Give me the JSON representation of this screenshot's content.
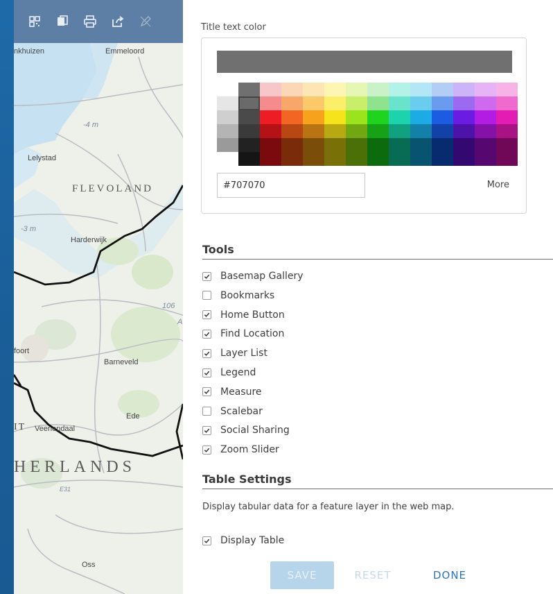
{
  "toolbar": {
    "icons": [
      "qr-code-icon",
      "copy-icon",
      "print-icon",
      "share-icon",
      "pencil-icon"
    ]
  },
  "map": {
    "labels": {
      "enkhuizen": "nkhuizen",
      "emmeloord": "Emmeloord",
      "elev1": "-4 m",
      "lelystad": "Lelystad",
      "flevoland": "FLEVOLAND",
      "elev2": "-3 m",
      "harderwijk": "Harderwijk",
      "road106": "106",
      "a": "A",
      "amersfoort": "foort",
      "barneveld": "Barneveld",
      "ede": "Ede",
      "veenendaal": "Veenendaal",
      "ut": "IT",
      "netherlands": "HERLANDS",
      "e31": "E31",
      "oss": "Oss"
    }
  },
  "panel": {
    "title_color_label": "Title text color",
    "preview_color": "#707070",
    "hex_value": "#707070",
    "more_label": "More",
    "tools_heading": "Tools",
    "tools": [
      {
        "label": "Basemap Gallery",
        "checked": true
      },
      {
        "label": "Bookmarks",
        "checked": false
      },
      {
        "label": "Home Button",
        "checked": true
      },
      {
        "label": "Find Location",
        "checked": true
      },
      {
        "label": "Layer List",
        "checked": true
      },
      {
        "label": "Legend",
        "checked": true
      },
      {
        "label": "Measure",
        "checked": true
      },
      {
        "label": "Scalebar",
        "checked": false
      },
      {
        "label": "Social Sharing",
        "checked": true
      },
      {
        "label": "Zoom Slider",
        "checked": true
      }
    ],
    "table_heading": "Table Settings",
    "table_description": "Display tabular data for a feature layer in the web map.",
    "display_table": {
      "label": "Display Table",
      "checked": true
    }
  },
  "footer": {
    "save_label": "SAVE",
    "reset_label": "RESET",
    "done_label": "DONE"
  },
  "palette": {
    "grays": [
      "#707070",
      "#e6e6e6",
      "#cfcfcf",
      "#b4b4b4",
      "#9a9a9a"
    ],
    "grays2": [
      "#707070",
      "#6a6a6a",
      "#4a4a4a",
      "#3a3a3a",
      "#222222",
      "#151515"
    ],
    "columns": [
      [
        "#f7c6c8",
        "#f48c8f",
        "#ee1c24",
        "#b51218",
        "#7a0a0e"
      ],
      [
        "#fbd7b5",
        "#f7a76a",
        "#f26522",
        "#b94714",
        "#7a2c0a"
      ],
      [
        "#fde6b3",
        "#fbc96a",
        "#f7a21c",
        "#b87412",
        "#7a4d08"
      ],
      [
        "#fdf6b3",
        "#fbee6a",
        "#f7e31c",
        "#b8a812",
        "#7a7008"
      ],
      [
        "#e6f7b3",
        "#c9ee6a",
        "#9be31c",
        "#71a812",
        "#4b7008"
      ],
      [
        "#c9f2c9",
        "#8fe38f",
        "#1fd31f",
        "#16a116",
        "#0c6b0c"
      ],
      [
        "#b3f2e6",
        "#6ae3cc",
        "#1cd3ac",
        "#12a180",
        "#086b54"
      ],
      [
        "#b3e6f7",
        "#6acdee",
        "#1cace3",
        "#1280a8",
        "#085470"
      ],
      [
        "#b3cdf7",
        "#6a9bee",
        "#1c5ce3",
        "#1242a8",
        "#082b70"
      ],
      [
        "#cdb3f7",
        "#9b6aee",
        "#6a1ce3",
        "#4d12a8",
        "#330870"
      ],
      [
        "#e6b3f7",
        "#cd6aee",
        "#b31ce3",
        "#8412a8",
        "#570870"
      ],
      [
        "#f7b3e6",
        "#ee6acd",
        "#e31cb3",
        "#a81284",
        "#700857"
      ]
    ]
  }
}
